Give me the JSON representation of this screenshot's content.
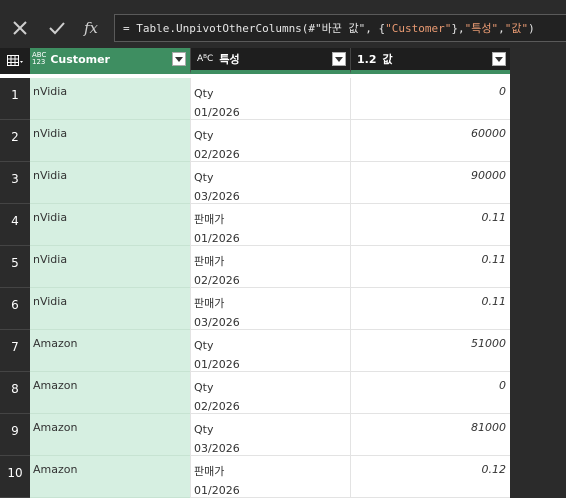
{
  "formula_bar": {
    "cancel_icon": "close-icon",
    "commit_icon": "check-icon",
    "fx_label": "fx",
    "formula_prefix": "= Table.UnpivotOtherColumns(#\"바꾼 값\", {",
    "formula_str1": "\"Customer\"",
    "formula_mid": "}, ",
    "formula_str2": "\"특성\"",
    "formula_sep": ", ",
    "formula_str3": "\"값\"",
    "formula_suffix": ")"
  },
  "grid": {
    "corner_icon": "table-icon",
    "columns": [
      {
        "type_top": "ABC",
        "type_bottom": "123",
        "label": "Customer"
      },
      {
        "type": "Aᴬ",
        "type_text": "AᴮC",
        "label": "특성"
      },
      {
        "type": "1.2",
        "label": "값"
      }
    ],
    "rows": [
      {
        "n": "1",
        "customer": "nVidia",
        "attr1": "Qty",
        "attr2": "01/2026",
        "value": "0"
      },
      {
        "n": "2",
        "customer": "nVidia",
        "attr1": "Qty",
        "attr2": "02/2026",
        "value": "60000"
      },
      {
        "n": "3",
        "customer": "nVidia",
        "attr1": "Qty",
        "attr2": "03/2026",
        "value": "90000"
      },
      {
        "n": "4",
        "customer": "nVidia",
        "attr1": "판매가",
        "attr2": "01/2026",
        "value": "0.11"
      },
      {
        "n": "5",
        "customer": "nVidia",
        "attr1": "판매가",
        "attr2": "02/2026",
        "value": "0.11"
      },
      {
        "n": "6",
        "customer": "nVidia",
        "attr1": "판매가",
        "attr2": "03/2026",
        "value": "0.11"
      },
      {
        "n": "7",
        "customer": "Amazon",
        "attr1": "Qty",
        "attr2": "01/2026",
        "value": "51000"
      },
      {
        "n": "8",
        "customer": "Amazon",
        "attr1": "Qty",
        "attr2": "02/2026",
        "value": "0"
      },
      {
        "n": "9",
        "customer": "Amazon",
        "attr1": "Qty",
        "attr2": "03/2026",
        "value": "81000"
      },
      {
        "n": "10",
        "customer": "Amazon",
        "attr1": "판매가",
        "attr2": "01/2026",
        "value": "0.12"
      }
    ]
  },
  "colors": {
    "selected_header": "#3e8e61",
    "selected_cells": "#d6efe1",
    "dark_chrome": "#2b2b2b",
    "formula_string": "#e99a72"
  }
}
